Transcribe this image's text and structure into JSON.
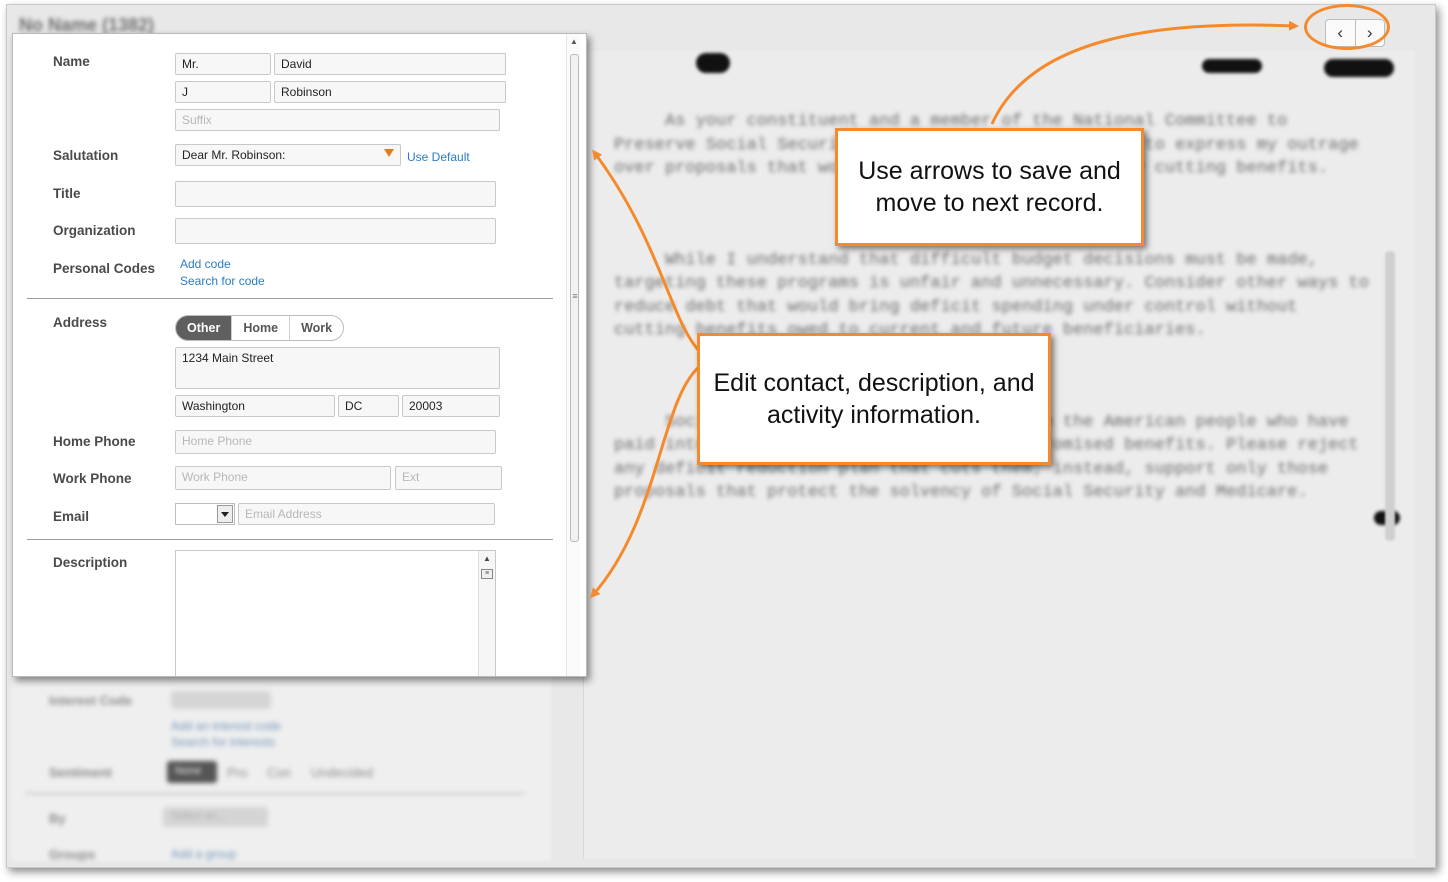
{
  "app": {
    "title": "No Name (1382)",
    "document_paragraphs": [
      "     As your constituent and a member of the National Committee to Preserve Social Security and Medicare, I am writing to express my outrage over proposals that would reduce federal deficits by cutting benefits.",
      "     While I understand that difficult budget decisions must be made, targeting these programs is unfair and unnecessary. Consider other ways to reduce debt that would bring deficit spending under control without cutting benefits owed to current and future beneficiaries.",
      "     Social Security and Medicare belong to the American people who have paid into these programs in exchange for promised benefits. Please reject any deficit reduction plan that cuts them; instead, support only those proposals that protect the solvency of Social Security and Medicare."
    ],
    "lower_left": {
      "interest_codes_label": "Interest Code",
      "add_interest_code": "Add an interest code",
      "search_interests": "Search for interests",
      "sentiment_label": "Sentiment",
      "sentiment_options": [
        "None",
        "Pro",
        "Con",
        "Undecided"
      ],
      "by_label": "By",
      "by_placeholder": "Select an...",
      "groups_label": "Groups",
      "add_group": "Add a group"
    }
  },
  "nav": {
    "prev_glyph": "‹",
    "next_glyph": "›"
  },
  "form": {
    "name": {
      "label": "Name",
      "prefix": "Mr.",
      "first": "David",
      "middle": "J",
      "last": "Robinson",
      "suffix_placeholder": "Suffix"
    },
    "salutation": {
      "label": "Salutation",
      "value": "Dear Mr. Robinson:",
      "use_default": "Use Default"
    },
    "title": {
      "label": "Title",
      "value": ""
    },
    "organization": {
      "label": "Organization",
      "value": ""
    },
    "personal_codes": {
      "label": "Personal Codes",
      "add_code": "Add code",
      "search_code": "Search for code"
    },
    "address": {
      "label": "Address",
      "tabs": [
        "Other",
        "Home",
        "Work"
      ],
      "active_tab": "Other",
      "street": "1234 Main Street",
      "city": "Washington",
      "state": "DC",
      "zip": "20003"
    },
    "home_phone": {
      "label": "Home Phone",
      "placeholder": "Home Phone"
    },
    "work_phone": {
      "label": "Work Phone",
      "placeholder": "Work Phone",
      "ext_placeholder": "Ext"
    },
    "email": {
      "label": "Email",
      "placeholder": "Email Address",
      "type_value": ""
    },
    "description": {
      "label": "Description",
      "value": ""
    }
  },
  "callouts": {
    "arrows_note": "Use arrows to save and move to next record.",
    "edit_note": "Edit contact, description, and activity information."
  },
  "colors": {
    "accent": "#f58a2c",
    "link": "#2a7dc4",
    "tab_active": "#5f5f5f"
  }
}
